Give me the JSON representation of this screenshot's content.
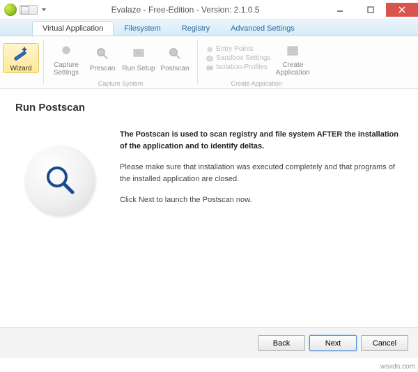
{
  "window": {
    "title": "Evalaze - Free-Edition - Version: 2.1.0.5"
  },
  "tabs": [
    {
      "label": "Virtual Application",
      "active": true
    },
    {
      "label": "Filesystem",
      "active": false
    },
    {
      "label": "Registry",
      "active": false
    },
    {
      "label": "Advanced Settings",
      "active": false
    }
  ],
  "ribbon": {
    "groups": [
      {
        "label": "",
        "items": [
          {
            "label": "Wizard",
            "icon": "wand-icon",
            "active": true
          }
        ]
      },
      {
        "label": "Capture System",
        "items": [
          {
            "label": "Capture Settings",
            "icon": "gear-icon"
          },
          {
            "label": "Prescan",
            "icon": "magnifier-icon"
          },
          {
            "label": "Run Setup",
            "icon": "run-icon"
          },
          {
            "label": "Postscan",
            "icon": "magnifier-icon"
          }
        ]
      },
      {
        "label": "Create Application",
        "menu": [
          {
            "label": "Entry Points",
            "icon": "dot-icon"
          },
          {
            "label": "Sandbox Settings",
            "icon": "shield-icon"
          },
          {
            "label": "Isolation-Profiles",
            "icon": "layers-icon"
          }
        ],
        "items": [
          {
            "label": "Create Application",
            "icon": "package-icon"
          }
        ]
      }
    ]
  },
  "page": {
    "title": "Run Postscan",
    "intro_bold": "The Postscan is used to scan registry and file system AFTER the installation of the application and to identify deltas.",
    "para2": "Please make sure that installation was executed completely and that programs of the installed application are closed.",
    "para3": "Click Next to launch the Postscan now."
  },
  "footer": {
    "back": "Back",
    "next": "Next",
    "cancel": "Cancel"
  },
  "watermark": "wsxdn.com"
}
